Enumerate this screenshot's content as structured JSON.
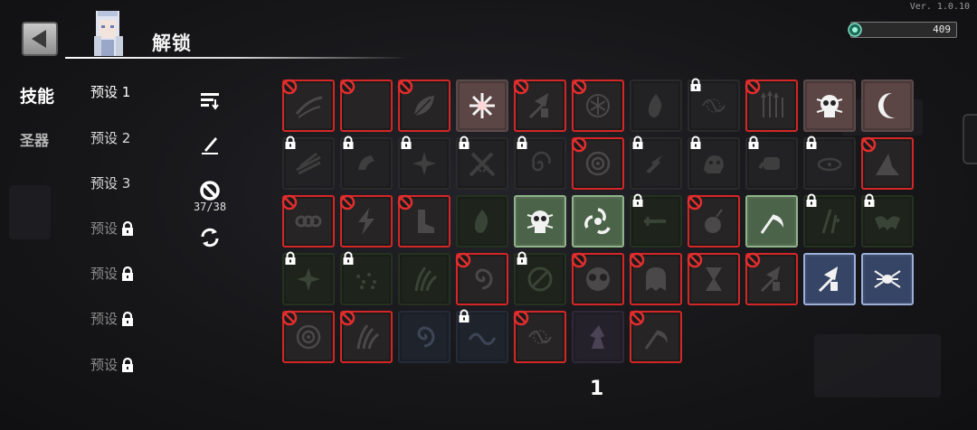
{
  "version": "Ver. 1.0.10",
  "header": {
    "title": "解锁",
    "currency_value": "409"
  },
  "categories": [
    {
      "label": "技能",
      "selected": true
    },
    {
      "label": "圣器",
      "selected": false
    }
  ],
  "presets": [
    {
      "label": "预设 1",
      "locked": false,
      "active": true
    },
    {
      "label": "预设 2",
      "locked": false,
      "active": false
    },
    {
      "label": "预设 3",
      "locked": false,
      "active": false
    },
    {
      "label": "预设",
      "locked": true
    },
    {
      "label": "预设",
      "locked": true
    },
    {
      "label": "预设",
      "locked": true
    },
    {
      "label": "预设",
      "locked": true
    }
  ],
  "tools": {
    "ban_count": "37/38",
    "icons": [
      "sort-icon",
      "edit-icon",
      "ban-icon",
      "refresh-icon"
    ]
  },
  "colors": {
    "banned_border": "#d32626",
    "highlight_green": "#8fb48a",
    "highlight_blue": "#9ab0d8"
  },
  "skill_rows": [
    [
      {
        "state": "banned",
        "glyph": "slash"
      },
      {
        "state": "banned",
        "glyph": "crescent"
      },
      {
        "state": "banned",
        "glyph": "leaf"
      },
      {
        "state": "lit-red",
        "glyph": "burst"
      },
      {
        "state": "banned",
        "glyph": "arrows"
      },
      {
        "state": "banned",
        "glyph": "rune"
      },
      {
        "state": "dim",
        "glyph": "flame"
      },
      {
        "state": "dim-lock",
        "glyph": "thorns"
      },
      {
        "state": "banned",
        "glyph": "spears"
      },
      {
        "state": "lit-red",
        "glyph": "skull"
      },
      {
        "state": "lit-red",
        "glyph": "moon"
      }
    ],
    [
      {
        "state": "dim-lock",
        "glyph": "feathers"
      },
      {
        "state": "dim-lock",
        "glyph": "hand"
      },
      {
        "state": "dim-lock",
        "glyph": "star"
      },
      {
        "state": "dim-lock",
        "glyph": "swords"
      },
      {
        "state": "dim-lock",
        "glyph": "vortex"
      },
      {
        "state": "banned",
        "glyph": "eye"
      },
      {
        "state": "dim-lock",
        "glyph": "spark"
      },
      {
        "state": "dim-lock",
        "glyph": "beast"
      },
      {
        "state": "dim-lock",
        "glyph": "fist"
      },
      {
        "state": "dim-lock",
        "glyph": "ring"
      },
      {
        "state": "banned",
        "glyph": "shard"
      }
    ],
    [
      {
        "state": "banned",
        "glyph": "chain"
      },
      {
        "state": "banned",
        "glyph": "bolt"
      },
      {
        "state": "banned",
        "glyph": "boot"
      },
      {
        "state": "dimgreen",
        "glyph": "flame"
      },
      {
        "state": "lit-green",
        "glyph": "skull"
      },
      {
        "state": "lit-green",
        "glyph": "biohazard"
      },
      {
        "state": "dimgreen-lock",
        "glyph": "sword"
      },
      {
        "state": "banned",
        "glyph": "bomb"
      },
      {
        "state": "lit-green",
        "glyph": "scythe"
      },
      {
        "state": "dimgreen-lock",
        "glyph": "daggers"
      },
      {
        "state": "dimgreen-lock",
        "glyph": "bat"
      }
    ],
    [
      {
        "state": "dimgreen-lock",
        "glyph": "star"
      },
      {
        "state": "dimgreen-lock",
        "glyph": "dots"
      },
      {
        "state": "dimgreen",
        "glyph": "claw"
      },
      {
        "state": "banned",
        "glyph": "spiral"
      },
      {
        "state": "dimgreen-lock",
        "glyph": "orb"
      },
      {
        "state": "banned",
        "glyph": "mask"
      },
      {
        "state": "banned",
        "glyph": "ghost"
      },
      {
        "state": "banned",
        "glyph": "hourglass"
      },
      {
        "state": "banned",
        "glyph": "arrows"
      },
      {
        "state": "lit-blue",
        "glyph": "arrows"
      },
      {
        "state": "lit-blue",
        "glyph": "spider"
      }
    ],
    [
      {
        "state": "banned",
        "glyph": "eye"
      },
      {
        "state": "banned",
        "glyph": "claw"
      },
      {
        "state": "dimblue",
        "glyph": "spiral"
      },
      {
        "state": "dimblue-lock",
        "glyph": "wave"
      },
      {
        "state": "banned",
        "glyph": "thorns"
      },
      {
        "state": "dimpurple",
        "glyph": "witch"
      },
      {
        "state": "banned",
        "glyph": "scythe"
      }
    ]
  ],
  "page_number": "1"
}
